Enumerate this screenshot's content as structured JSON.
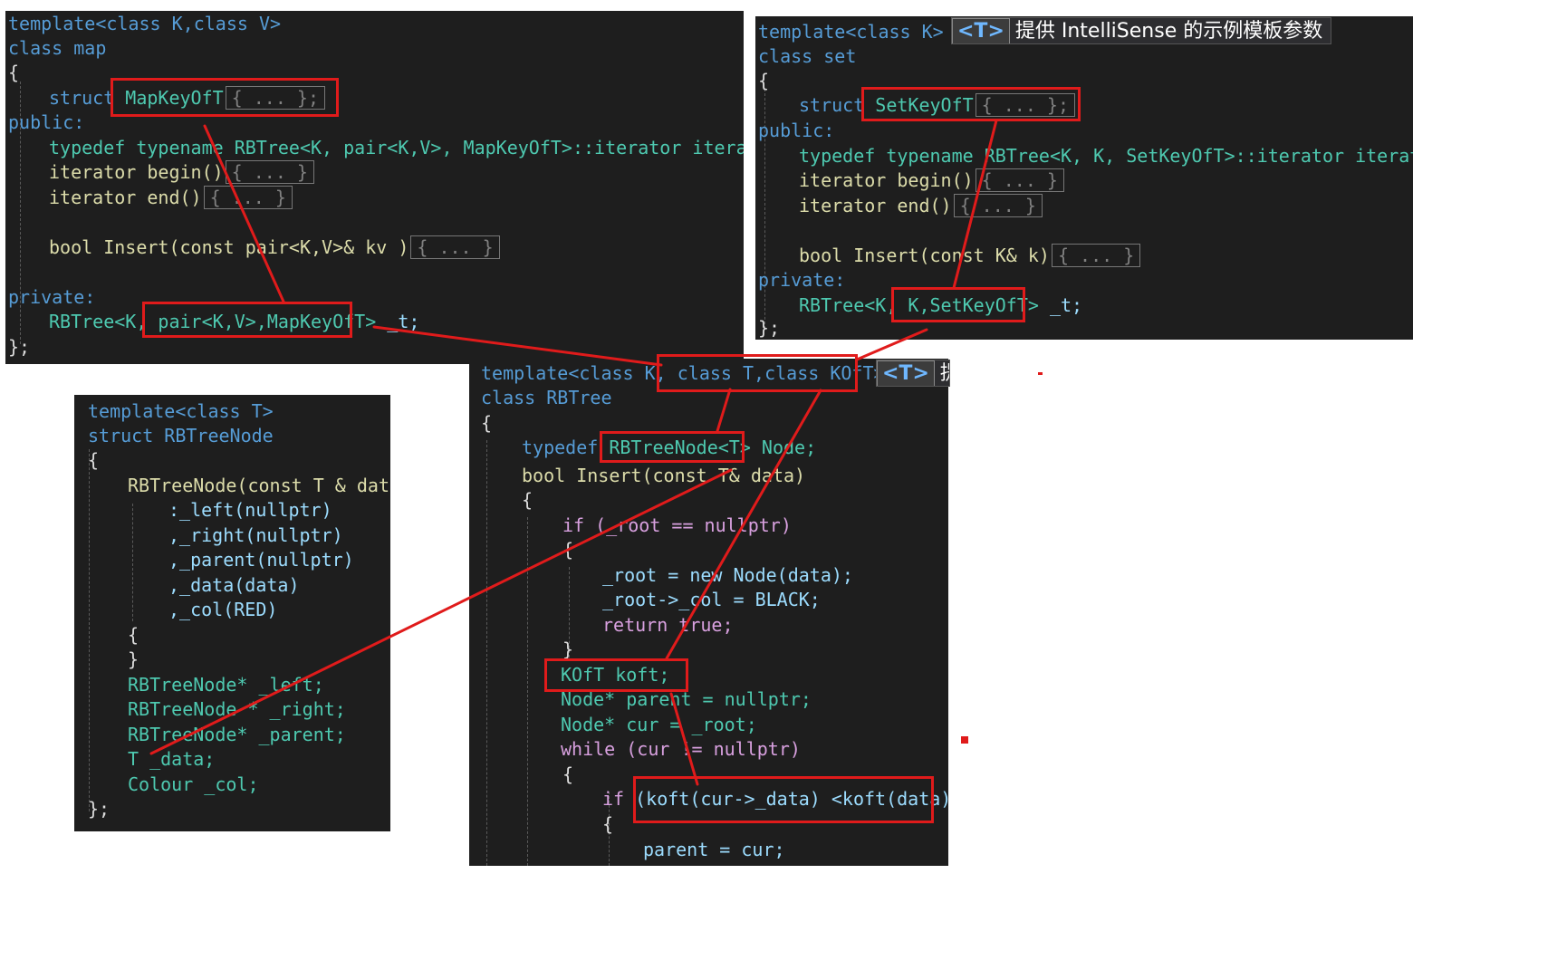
{
  "colors": {
    "panel_bg": "#1e1e1e",
    "highlight_red": "#e01b1b",
    "keyword": "#569cd6",
    "type": "#4ec9b0",
    "function": "#dcdcaa",
    "macro": "#bd63c5"
  },
  "tooltip": {
    "badge": "<T>",
    "text": "提供 IntelliSense 的示例模板参数",
    "text_partial": "提供"
  },
  "map_panel": {
    "line1": "template<class K,class V>",
    "line2": "class map",
    "line3": "{",
    "struct_kw": "struct",
    "struct_name": "MapKeyOfT",
    "struct_body": "{ ... };",
    "public": "public:",
    "typedef": "typedef typename RBTree<K, pair<K,V>, MapKeyOfT>::iterator iterator;",
    "begin": "iterator begin()",
    "begin_body": "{ ... }",
    "end": "iterator end()",
    "end_body": "{ ... }",
    "insert": "bool Insert(const pair<K,V>& kv )",
    "insert_body": "{ ... }",
    "private": "private:",
    "member_pre": "RBTree<K, ",
    "member_hl": "pair<K,V>,MapKeyOfT>",
    "member_post": " _t;",
    "close": "};"
  },
  "set_panel": {
    "line1": "template<class K>",
    "line2": "class set",
    "line3": "{",
    "struct_kw": "struct",
    "struct_name": "SetKeyOfT",
    "struct_body": "{ ... };",
    "public": "public:",
    "typedef": "typedef typename RBTree<K, K, SetKeyOfT>::iterator iterator;",
    "begin": "iterator begin()",
    "begin_body": "{ ... }",
    "end": "iterator end()",
    "end_body": "{ ... }",
    "insert": "bool Insert(const K& k)",
    "insert_body": "{ ... }",
    "private": "private:",
    "member_pre": "RBTree<K, ",
    "member_hl": "K,SetKeyOfT>",
    "member_post": " _t;",
    "close": "};"
  },
  "node_panel": {
    "lines": [
      "template<class T>",
      "struct RBTreeNode",
      "{",
      "RBTreeNode(const T & data)",
      ":_left(nullptr)",
      ",_right(nullptr)",
      ",_parent(nullptr)",
      ",_data(data)",
      ",_col(RED)",
      "{",
      "}",
      "RBTreeNode* _left;",
      "RBTreeNode * _right;",
      "RBTreeNode* _parent;",
      "T _data;",
      "Colour _col;",
      "};"
    ]
  },
  "tree_panel": {
    "tpl_pre": "template<class K, ",
    "tpl_hl": "class T,class KOfT>",
    "class_line": "class RBTree",
    "open": "{",
    "typedef_kw": "typedef ",
    "typedef_hl": "RBTreeNode<T>",
    "typedef_post": " Node;",
    "insert": "bool Insert(const T& data)",
    "open2": "{",
    "if_root": "if (_root == nullptr)",
    "open3": "{",
    "root_new": "_root = new Node(data);",
    "root_col": "_root->_col = BLACK;",
    "ret": "return true;",
    "close3": "}",
    "koft": "KOfT koft;",
    "parent": "Node* parent = nullptr;",
    "cur": "Node* cur = _root;",
    "while": "while (cur != nullptr)",
    "open4": "{",
    "if_kw": "if ",
    "if_hl": "(koft(cur->_data) <koft(data))",
    "open5": "{",
    "parent_assign": "parent = cur;"
  }
}
